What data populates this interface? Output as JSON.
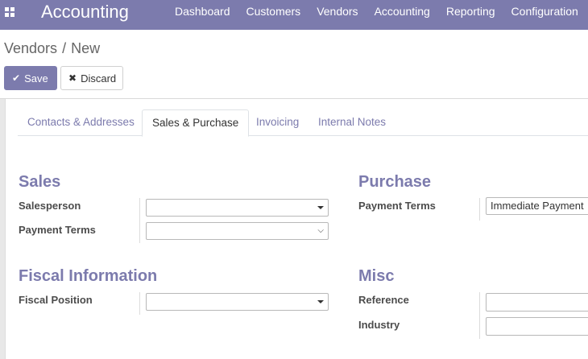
{
  "app": {
    "title": "Accounting",
    "menu": [
      "Dashboard",
      "Customers",
      "Vendors",
      "Accounting",
      "Reporting",
      "Configuration"
    ]
  },
  "breadcrumb": {
    "parent": "Vendors",
    "separator": "/",
    "current": "New"
  },
  "toolbar": {
    "save_label": "Save",
    "discard_label": "Discard"
  },
  "tabs": [
    {
      "label": "Contacts & Addresses",
      "active": false
    },
    {
      "label": "Sales & Purchase",
      "active": true
    },
    {
      "label": "Invoicing",
      "active": false
    },
    {
      "label": "Internal Notes",
      "active": false
    }
  ],
  "sales": {
    "title": "Sales",
    "salesperson_label": "Salesperson",
    "salesperson_value": "",
    "payment_terms_label": "Payment Terms",
    "payment_terms_value": ""
  },
  "purchase": {
    "title": "Purchase",
    "payment_terms_label": "Payment Terms",
    "payment_terms_value": "Immediate Payment"
  },
  "fiscal": {
    "title": "Fiscal Information",
    "fiscal_position_label": "Fiscal Position",
    "fiscal_position_value": ""
  },
  "misc": {
    "title": "Misc",
    "reference_label": "Reference",
    "reference_value": "",
    "industry_label": "Industry",
    "industry_value": ""
  },
  "colors": {
    "brand": "#7c7bad",
    "text": "#4c4c4c"
  },
  "icons": {
    "apps": "apps-grid-icon",
    "save": "check-icon",
    "discard": "close-icon"
  }
}
